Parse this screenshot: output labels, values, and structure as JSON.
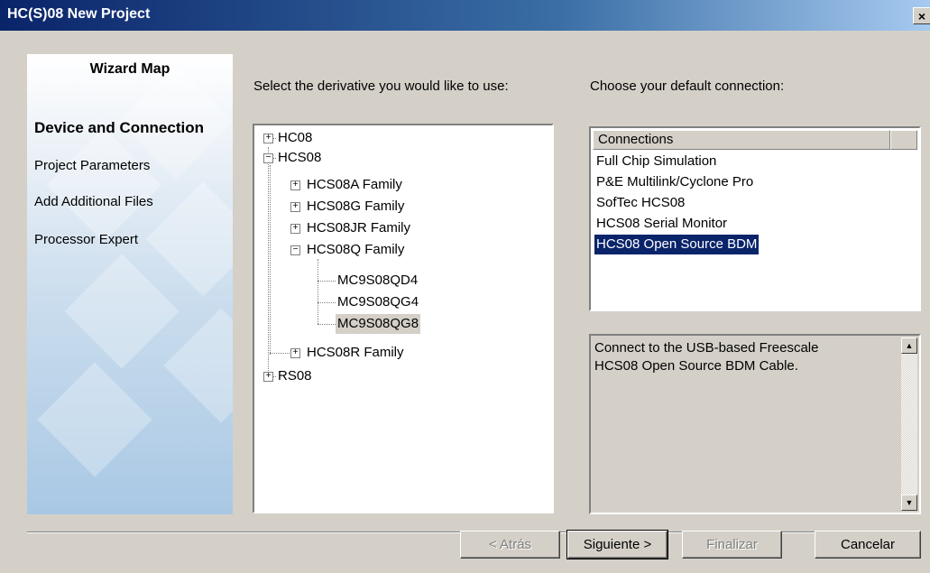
{
  "window": {
    "title": "HC(S)08 New Project",
    "close_glyph": "×"
  },
  "sidebar": {
    "heading": "Wizard Map",
    "items": [
      {
        "label": "Device and Connection",
        "active": true
      },
      {
        "label": "Project Parameters",
        "active": false
      },
      {
        "label": "Add Additional Files",
        "active": false
      },
      {
        "label": "Processor Expert",
        "active": false
      }
    ]
  },
  "derivative": {
    "prompt": "Select the derivative you would like to use:",
    "tree": [
      {
        "label": "HC08",
        "expander": "+"
      },
      {
        "label": "HCS08",
        "expander": "−"
      },
      {
        "label": "HCS08A Family",
        "expander": "+"
      },
      {
        "label": "HCS08G Family",
        "expander": "+"
      },
      {
        "label": "HCS08JR Family",
        "expander": "+"
      },
      {
        "label": "HCS08Q Family",
        "expander": "−"
      },
      {
        "label": "MC9S08QD4",
        "expander": ""
      },
      {
        "label": "MC9S08QG4",
        "expander": ""
      },
      {
        "label": "MC9S08QG8",
        "expander": "",
        "selected": true
      },
      {
        "label": "HCS08R Family",
        "expander": "+"
      },
      {
        "label": "RS08",
        "expander": "+"
      }
    ]
  },
  "connection": {
    "prompt": "Choose your default connection:",
    "column_header": "Connections",
    "items": [
      {
        "label": "Full Chip Simulation"
      },
      {
        "label": "P&E Multilink/Cyclone Pro"
      },
      {
        "label": "SofTec HCS08"
      },
      {
        "label": "HCS08 Serial Monitor"
      },
      {
        "label": "HCS08 Open Source BDM",
        "selected": true
      }
    ],
    "description_line1": "Connect to the USB-based Freescale",
    "description_line2": "HCS08 Open Source BDM Cable.",
    "scroll_up_glyph": "▲",
    "scroll_down_glyph": "▼"
  },
  "buttons": {
    "back": "< Atrás",
    "next": "Siguiente >",
    "finish": "Finalizar",
    "cancel": "Cancelar"
  },
  "colors": {
    "selection": "#0a246a",
    "titlebar": "#0a246a",
    "face": "#d4d0c8"
  }
}
